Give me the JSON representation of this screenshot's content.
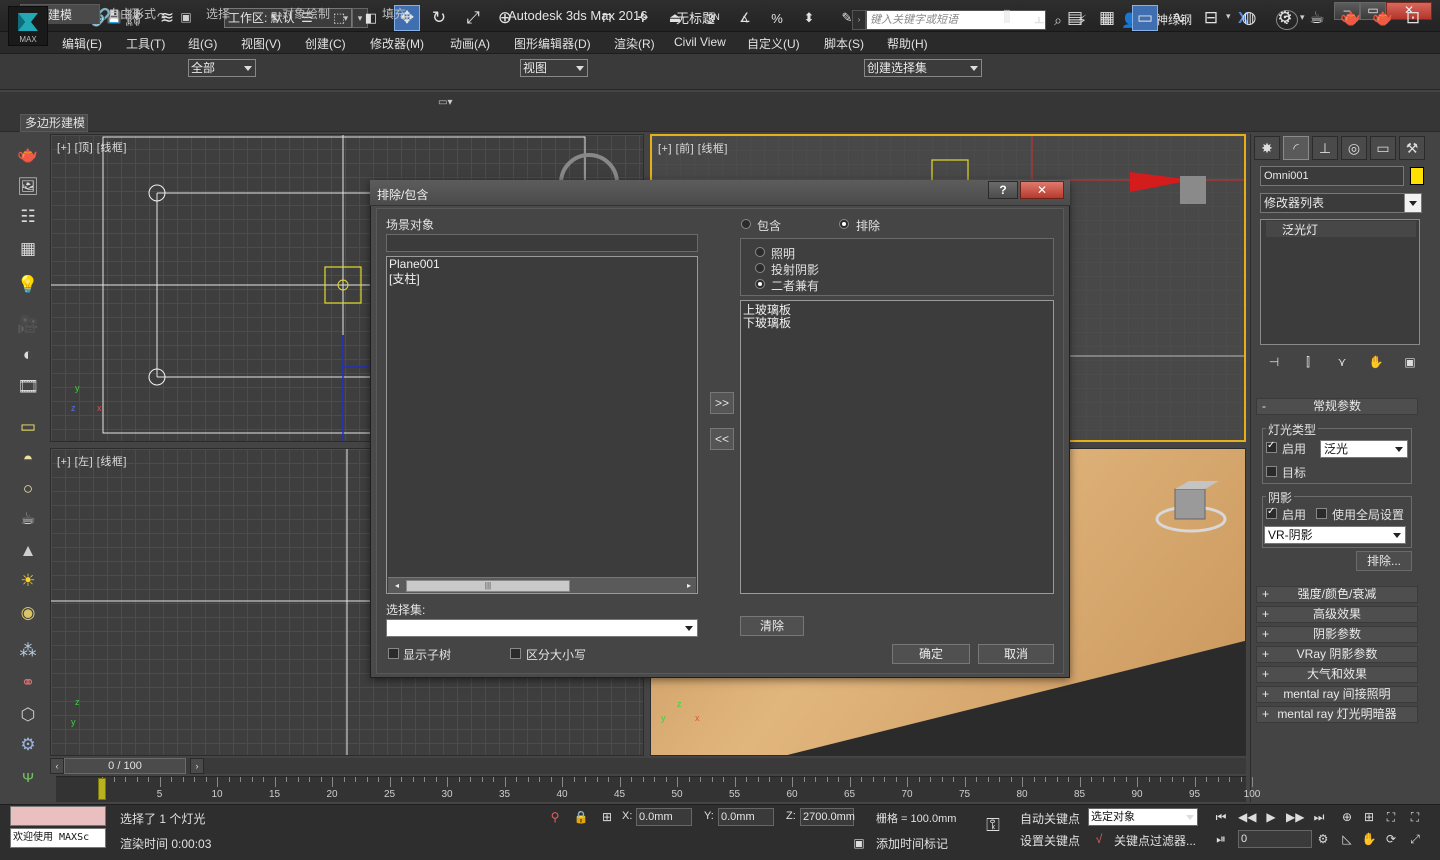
{
  "app": {
    "name": "Autodesk 3ds Max 2016",
    "document": "无标题",
    "logo_text": "MAX",
    "workspace": "工作区: 默认",
    "search_placeholder": "键入关键字或短语",
    "user": "钢神绿钢"
  },
  "menubar": [
    "编辑(E)",
    "工具(T)",
    "组(G)",
    "视图(V)",
    "创建(C)",
    "修改器(M)",
    "动画(A)",
    "图形编辑器(D)",
    "渲染(R)",
    "Civil View",
    "自定义(U)",
    "脚本(S)",
    "帮助(H)"
  ],
  "toolbar": {
    "selection_filter": "全部",
    "coord_system": "视图",
    "named_selection": "创建选择集"
  },
  "ribbon": {
    "tabs": [
      "建模",
      "自由形式",
      "选择",
      "对象绘制",
      "填充"
    ],
    "panel": "多边形建模"
  },
  "viewports": {
    "top": "[+] [顶] [线框]",
    "front": "[+] [前] [线框]",
    "left": "[+] [左] [线框]"
  },
  "timeline": {
    "frame_display": "0 / 100",
    "ticks": [
      "5",
      "10",
      "15",
      "20",
      "25",
      "30",
      "35",
      "40",
      "45",
      "50",
      "55",
      "60",
      "65",
      "70",
      "75",
      "80",
      "85",
      "90",
      "95",
      "100"
    ]
  },
  "status": {
    "maxscript_welcome": "欢迎使用 MAXSc",
    "selection_info": "选择了 1 个灯光",
    "render_time": "渲染时间  0:00:03",
    "x_label": "X:",
    "x_value": "0.0mm",
    "y_label": "Y:",
    "y_value": "0.0mm",
    "z_label": "Z:",
    "z_value": "2700.0mm",
    "grid": "栅格 = 100.0mm",
    "add_time_tag": "添加时间标记",
    "auto_key": "自动关键点",
    "selected_object": "选定对象",
    "set_key": "设置关键点",
    "key_filters": "关键点过滤器...",
    "current_frame": "0"
  },
  "command_panel": {
    "object_name": "Omni001",
    "object_color": "#ffe100",
    "modifier_list": "修改器列表",
    "stack_item": "泛光灯",
    "general_rollout": "常规参数",
    "light_type_group": "灯光类型",
    "enable_label": "启用",
    "light_type_value": "泛光",
    "target_label": "目标",
    "shadows_group": "阴影",
    "shadow_enable_label": "启用",
    "use_global_label": "使用全局设置",
    "shadow_type": "VR-阴影",
    "exclude_button": "排除...",
    "rollouts": [
      "强度/颜色/衰减",
      "高级效果",
      "阴影参数",
      "VRay 阴影参数",
      "大气和效果",
      "mental ray 间接照明",
      "mental ray 灯光明暗器"
    ]
  },
  "dialog": {
    "title": "排除/包含",
    "help": "?",
    "close": "✕",
    "scene_objects_label": "场景对象",
    "scene_objects": [
      "Plane001",
      "[支柱]"
    ],
    "include_label": "包含",
    "exclude_label": "排除",
    "mode_selected": "exclude",
    "illumination_label": "照明",
    "shadow_casting_label": "投射阴影",
    "both_label": "二者兼有",
    "type_selected": "both",
    "excluded_objects": [
      "上玻璃板",
      "下玻璃板"
    ],
    "add_button": ">>",
    "remove_button": "<<",
    "selection_sets_label": "选择集:",
    "clear_button": "清除",
    "show_subtree_label": "显示子树",
    "case_sensitive_label": "区分大小写",
    "ok_button": "确定",
    "cancel_button": "取消"
  }
}
